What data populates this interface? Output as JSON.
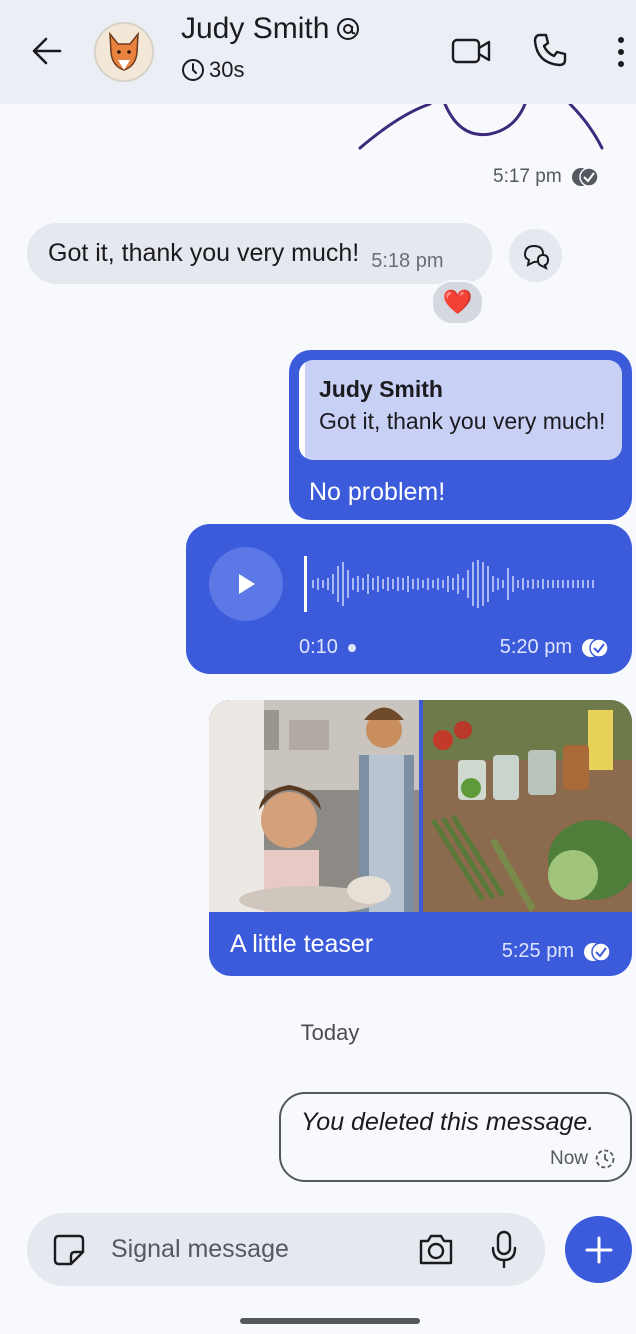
{
  "header": {
    "contact_name": "Judy Smith",
    "timer": "30s"
  },
  "messages": {
    "sticker_time": "5:17 pm",
    "incoming_text": "Got it, thank you very much!",
    "incoming_time": "5:18 pm",
    "reaction": "❤️",
    "reply_quote_name": "Judy Smith",
    "reply_quote_text": "Got it, thank you very much!",
    "reply_text": "No problem!",
    "voice_duration": "0:10",
    "voice_time": "5:20 pm",
    "media_caption": "A little teaser",
    "media_time": "5:25 pm",
    "date_divider": "Today",
    "deleted_text": "You deleted this message.",
    "deleted_time": "Now"
  },
  "composer": {
    "placeholder": "Signal message"
  },
  "colors": {
    "accent": "#3b5bdb",
    "header_bg": "#eceef6",
    "bubble_in": "#e6e8ef"
  }
}
